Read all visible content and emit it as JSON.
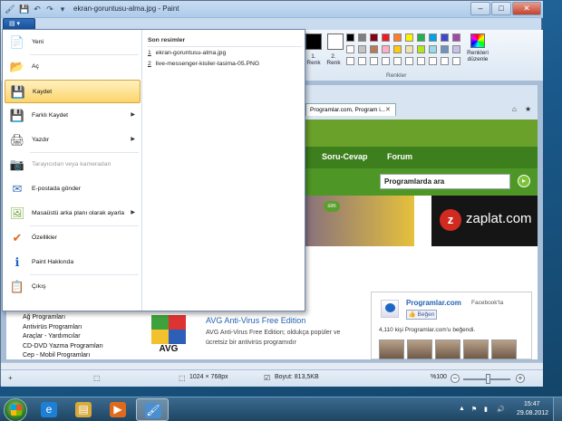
{
  "window": {
    "title": "ekran-goruntusu-alma.jpg - Paint",
    "minimize_glyph": "–",
    "maximize_glyph": "□",
    "close_glyph": "✕"
  },
  "app_button": {
    "label": "▤ ▾"
  },
  "ribbon": {
    "color1_label": "1.\nRenk",
    "color2_label": "2.\nRenk",
    "edit_colors_label": "Renkleri düzenle",
    "group_label": "Renkler",
    "palette_row1": [
      "#000000",
      "#7f7f7f",
      "#880015",
      "#ed1c24",
      "#ff7f27",
      "#fff200",
      "#22b14c",
      "#00a2e8",
      "#3f48cc",
      "#a349a4"
    ],
    "palette_row2": [
      "#ffffff",
      "#c3c3c3",
      "#b97a57",
      "#ffaec9",
      "#ffc90e",
      "#efe4b0",
      "#b5e61d",
      "#99d9ea",
      "#7092be",
      "#c8bfe7"
    ],
    "palette_row3": [
      "#ffffff",
      "#ffffff",
      "#ffffff",
      "#ffffff",
      "#ffffff",
      "#ffffff",
      "#ffffff",
      "#ffffff",
      "#ffffff",
      "#ffffff"
    ]
  },
  "app_menu": {
    "items": [
      {
        "label": "Yeni",
        "icon": "📄"
      },
      {
        "label": "Aç",
        "icon": "📂"
      },
      {
        "label": "Kaydet",
        "icon": "💾"
      },
      {
        "label": "Farklı Kaydet",
        "icon": "💾",
        "arrow": "▶"
      },
      {
        "label": "Yazdır",
        "icon": "🖨",
        "arrow": "▶"
      },
      {
        "label": "Tarayıcıdan veya kameradan",
        "icon": "📷"
      },
      {
        "label": "E-postada gönder",
        "icon": "✉"
      },
      {
        "label": "Masaüstü arka planı olarak ayarla",
        "icon": "🖼",
        "arrow": "▶"
      },
      {
        "label": "Özellikler",
        "icon": "✔"
      },
      {
        "label": "Paint Hakkında",
        "icon": "ℹ"
      },
      {
        "label": "Çıkış",
        "icon": "📋"
      }
    ],
    "recent_title": "Son resimler",
    "recent": [
      {
        "num": "1",
        "name": "ekran-goruntusu-alma.jpg"
      },
      {
        "num": "2",
        "name": "live-messenger-kisiler-tasima-05.PNG"
      }
    ]
  },
  "browser_image": {
    "tab_title": "Programlar.com, Program i...",
    "tab_close": "✕",
    "home_glyph": "⌂",
    "star_glyph": "★",
    "nav": [
      "Soru-Cevap",
      "Forum"
    ],
    "search_text": "Programlarda ara",
    "search_go": "▸",
    "sim_badge": "sim",
    "zplat_mark": "z",
    "zplat_text": "zaplat.com",
    "side_links": [
      "Ağ Programları",
      "Antivirüs Programları",
      "Araçlar - Yardımcılar",
      "CD-DVD Yazma Programları",
      "Cep - Mobil Programları"
    ],
    "avg_logo_text": "AVG",
    "avg_title": "AVG Anti-Virus Free Edition",
    "avg_desc": "AVG Anti-Virus Free Edition; oldukça popüler ve ücretsiz bir antivirüs programıdır",
    "fb_title": "Programlar.com",
    "fb_sub": "Facebook'ta",
    "fb_like": "👍 Beğen",
    "fb_count": "4,110 kişi Programlar.com'u beğendi."
  },
  "statusbar": {
    "add_glyph": "+",
    "select_glyph": "⬚",
    "dimensions": "1024 × 768px",
    "size": "Boyut: 813,5KB",
    "zoom": "%100",
    "zoom_out": "−",
    "zoom_in": "+"
  },
  "taskbar": {
    "apps": [
      {
        "icon": "e",
        "color": "#1e7fd6"
      },
      {
        "icon": "▤",
        "color": "#d8a93b"
      },
      {
        "icon": "▶",
        "color": "#e06a1b"
      },
      {
        "icon": "🖌",
        "color": "#4a8fd0"
      }
    ],
    "tray": [
      "▲",
      "⚑",
      "▮",
      "🔊"
    ],
    "time": "15:47",
    "date": "29.08.2012"
  }
}
